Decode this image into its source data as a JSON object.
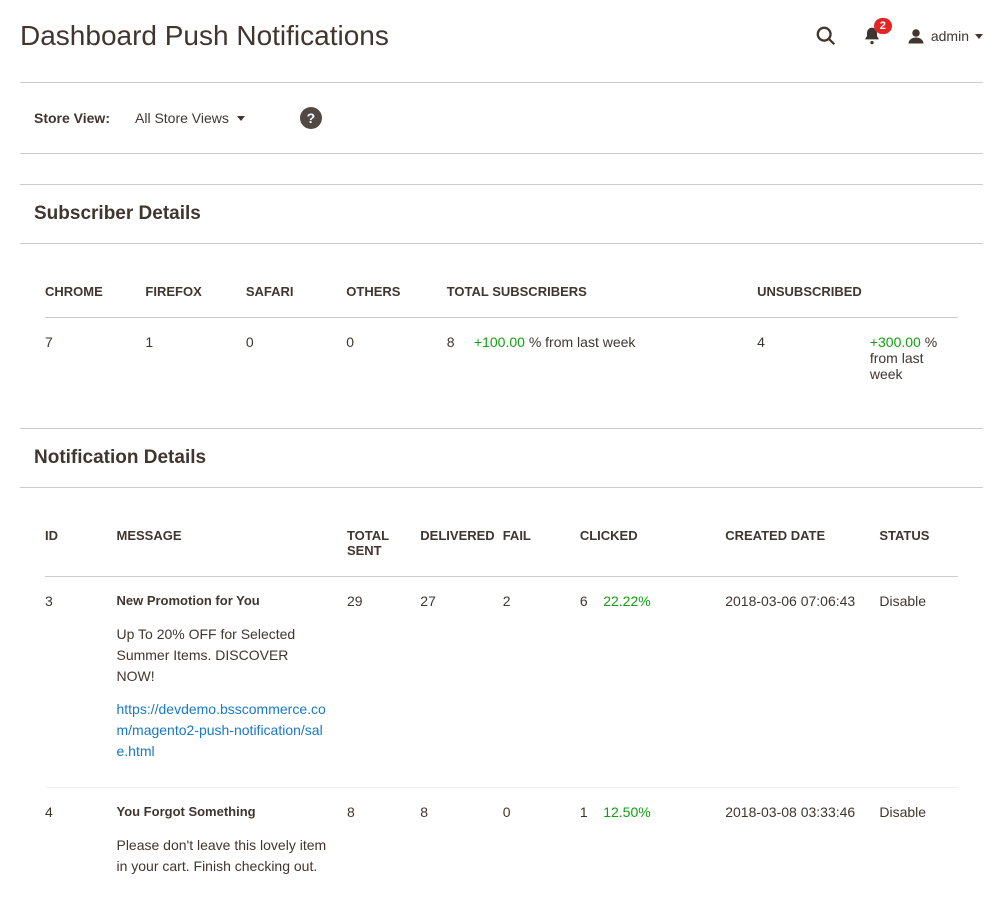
{
  "header": {
    "title": "Dashboard Push Notifications",
    "badge_count": "2",
    "user_label": "admin"
  },
  "store_bar": {
    "label": "Store View:",
    "selected": "All Store Views",
    "help": "?"
  },
  "subscriber_section": {
    "title": "Subscriber Details",
    "headers": {
      "chrome": "CHROME",
      "firefox": "FIREFOX",
      "safari": "SAFARI",
      "others": "OTHERS",
      "total": "TOTAL SUBSCRIBERS",
      "unsub": "UNSUBSCRIBED"
    },
    "row": {
      "chrome": "7",
      "firefox": "1",
      "safari": "0",
      "others": "0",
      "total": "8",
      "total_change": "+100.00",
      "total_suffix": " % from last week",
      "unsub": "4",
      "unsub_change": "+300.00",
      "unsub_suffix": " % from last week"
    }
  },
  "notif_section": {
    "title": "Notification Details",
    "headers": {
      "id": "ID",
      "message": "MESSAGE",
      "total_sent": "TOTAL SENT",
      "delivered": "DELIVERED",
      "fail": "FAIL",
      "clicked": "CLICKED",
      "created": "CREATED DATE",
      "status": "STATUS"
    },
    "rows": [
      {
        "id": "3",
        "title": "New Promotion for You",
        "body": "Up To 20% OFF for Selected Summer Items. DISCOVER NOW!",
        "link": "https://devdemo.bsscommerce.com/magento2-push-notification/sale.html",
        "total_sent": "29",
        "delivered": "27",
        "fail": "2",
        "clicked": "6",
        "clicked_pct": "22.22%",
        "created": "2018-03-06 07:06:43",
        "status": "Disable"
      },
      {
        "id": "4",
        "title": "You Forgot Something",
        "body": "Please don't leave this lovely item in your cart. Finish checking out.",
        "link": "",
        "total_sent": "8",
        "delivered": "8",
        "fail": "0",
        "clicked": "1",
        "clicked_pct": "12.50%",
        "created": "2018-03-08 03:33:46",
        "status": "Disable"
      }
    ]
  }
}
